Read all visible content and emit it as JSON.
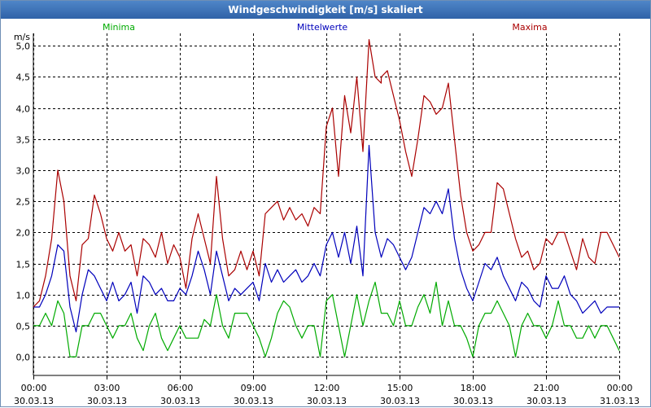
{
  "window": {
    "title": "Windgeschwindigkeit [m/s] skaliert"
  },
  "chart_data": {
    "type": "line",
    "title": "Windgeschwindigkeit [m/s] skaliert",
    "ylabel": "m/s",
    "xlabel": "",
    "ylim": [
      -0.3,
      5.2
    ],
    "xlim": [
      0,
      24
    ],
    "grid": true,
    "legend_placement": "top",
    "y_ticks": [
      "0,0",
      "0,5",
      "1,0",
      "1,5",
      "2,0",
      "2,5",
      "3,0",
      "3,5",
      "4,0",
      "4,5",
      "5,0"
    ],
    "y_tick_values": [
      0,
      0.5,
      1,
      1.5,
      2,
      2.5,
      3,
      3.5,
      4,
      4.5,
      5
    ],
    "x_ticks": [
      {
        "time": "00:00",
        "date": "30.03.13",
        "hour": 0
      },
      {
        "time": "03:00",
        "date": "30.03.13",
        "hour": 3
      },
      {
        "time": "06:00",
        "date": "30.03.13",
        "hour": 6
      },
      {
        "time": "09:00",
        "date": "30.03.13",
        "hour": 9
      },
      {
        "time": "12:00",
        "date": "30.03.13",
        "hour": 12
      },
      {
        "time": "15:00",
        "date": "30.03.13",
        "hour": 15
      },
      {
        "time": "18:00",
        "date": "30.03.13",
        "hour": 18
      },
      {
        "time": "21:00",
        "date": "30.03.13",
        "hour": 21
      },
      {
        "time": "00:00",
        "date": "31.03.13",
        "hour": 24
      }
    ],
    "series": [
      {
        "name": "Minima",
        "color": "#00aa00",
        "points": [
          [
            0,
            0.5
          ],
          [
            0.25,
            0.5
          ],
          [
            0.5,
            0.7
          ],
          [
            0.75,
            0.5
          ],
          [
            1,
            0.9
          ],
          [
            1.25,
            0.7
          ],
          [
            1.5,
            0
          ],
          [
            1.75,
            0
          ],
          [
            2,
            0.5
          ],
          [
            2.25,
            0.5
          ],
          [
            2.5,
            0.7
          ],
          [
            2.75,
            0.7
          ],
          [
            3,
            0.5
          ],
          [
            3.25,
            0.3
          ],
          [
            3.5,
            0.5
          ],
          [
            3.75,
            0.5
          ],
          [
            4,
            0.7
          ],
          [
            4.25,
            0.3
          ],
          [
            4.5,
            0.1
          ],
          [
            4.75,
            0.5
          ],
          [
            5,
            0.7
          ],
          [
            5.25,
            0.3
          ],
          [
            5.5,
            0.1
          ],
          [
            5.75,
            0.3
          ],
          [
            6,
            0.5
          ],
          [
            6.25,
            0.3
          ],
          [
            6.5,
            0.3
          ],
          [
            6.75,
            0.3
          ],
          [
            7,
            0.6
          ],
          [
            7.25,
            0.5
          ],
          [
            7.5,
            1.0
          ],
          [
            7.75,
            0.5
          ],
          [
            8,
            0.3
          ],
          [
            8.25,
            0.7
          ],
          [
            8.5,
            0.7
          ],
          [
            8.75,
            0.7
          ],
          [
            9,
            0.5
          ],
          [
            9.25,
            0.3
          ],
          [
            9.5,
            0
          ],
          [
            9.75,
            0.3
          ],
          [
            10,
            0.7
          ],
          [
            10.25,
            0.9
          ],
          [
            10.5,
            0.8
          ],
          [
            10.75,
            0.5
          ],
          [
            11,
            0.3
          ],
          [
            11.25,
            0.5
          ],
          [
            11.5,
            0.5
          ],
          [
            11.75,
            0
          ],
          [
            12,
            0.9
          ],
          [
            12.25,
            1.0
          ],
          [
            12.5,
            0.5
          ],
          [
            12.75,
            0
          ],
          [
            13,
            0.5
          ],
          [
            13.25,
            1.0
          ],
          [
            13.5,
            0.5
          ],
          [
            13.75,
            0.9
          ],
          [
            14,
            1.2
          ],
          [
            14.25,
            0.7
          ],
          [
            14.5,
            0.7
          ],
          [
            14.75,
            0.5
          ],
          [
            15,
            0.9
          ],
          [
            15.25,
            0.5
          ],
          [
            15.5,
            0.5
          ],
          [
            15.75,
            0.8
          ],
          [
            16,
            1.0
          ],
          [
            16.25,
            0.7
          ],
          [
            16.5,
            1.2
          ],
          [
            16.75,
            0.5
          ],
          [
            17,
            0.9
          ],
          [
            17.25,
            0.5
          ],
          [
            17.5,
            0.5
          ],
          [
            17.75,
            0.3
          ],
          [
            18,
            0
          ],
          [
            18.25,
            0.5
          ],
          [
            18.5,
            0.7
          ],
          [
            18.75,
            0.7
          ],
          [
            19,
            0.9
          ],
          [
            19.25,
            0.7
          ],
          [
            19.5,
            0.5
          ],
          [
            19.75,
            0
          ],
          [
            20,
            0.5
          ],
          [
            20.25,
            0.7
          ],
          [
            20.5,
            0.5
          ],
          [
            20.75,
            0.5
          ],
          [
            21,
            0.3
          ],
          [
            21.25,
            0.5
          ],
          [
            21.5,
            0.9
          ],
          [
            21.75,
            0.5
          ],
          [
            22,
            0.5
          ],
          [
            22.25,
            0.3
          ],
          [
            22.5,
            0.3
          ],
          [
            22.75,
            0.5
          ],
          [
            23,
            0.3
          ],
          [
            23.25,
            0.5
          ],
          [
            23.5,
            0.5
          ],
          [
            23.75,
            0.3
          ],
          [
            24,
            0.1
          ]
        ]
      },
      {
        "name": "Mittelwerte",
        "color": "#0000bb",
        "points": [
          [
            0,
            0.8
          ],
          [
            0.25,
            0.8
          ],
          [
            0.5,
            1.0
          ],
          [
            0.75,
            1.3
          ],
          [
            1,
            1.8
          ],
          [
            1.25,
            1.7
          ],
          [
            1.5,
            0.8
          ],
          [
            1.75,
            0.4
          ],
          [
            2,
            1.0
          ],
          [
            2.25,
            1.4
          ],
          [
            2.5,
            1.3
          ],
          [
            2.75,
            1.1
          ],
          [
            3,
            0.9
          ],
          [
            3.25,
            1.2
          ],
          [
            3.5,
            0.9
          ],
          [
            3.75,
            1.0
          ],
          [
            4,
            1.2
          ],
          [
            4.25,
            0.7
          ],
          [
            4.5,
            1.3
          ],
          [
            4.75,
            1.2
          ],
          [
            5,
            1.0
          ],
          [
            5.25,
            1.1
          ],
          [
            5.5,
            0.9
          ],
          [
            5.75,
            0.9
          ],
          [
            6,
            1.1
          ],
          [
            6.25,
            1.0
          ],
          [
            6.5,
            1.3
          ],
          [
            6.75,
            1.7
          ],
          [
            7,
            1.4
          ],
          [
            7.25,
            1.0
          ],
          [
            7.5,
            1.7
          ],
          [
            7.75,
            1.3
          ],
          [
            8,
            0.9
          ],
          [
            8.25,
            1.1
          ],
          [
            8.5,
            1.0
          ],
          [
            8.75,
            1.1
          ],
          [
            9,
            1.2
          ],
          [
            9.25,
            0.9
          ],
          [
            9.5,
            1.5
          ],
          [
            9.75,
            1.2
          ],
          [
            10,
            1.4
          ],
          [
            10.25,
            1.2
          ],
          [
            10.5,
            1.3
          ],
          [
            10.75,
            1.4
          ],
          [
            11,
            1.2
          ],
          [
            11.25,
            1.3
          ],
          [
            11.5,
            1.5
          ],
          [
            11.75,
            1.3
          ],
          [
            12,
            1.8
          ],
          [
            12.25,
            2.0
          ],
          [
            12.5,
            1.6
          ],
          [
            12.75,
            2.0
          ],
          [
            13,
            1.5
          ],
          [
            13.25,
            2.1
          ],
          [
            13.5,
            1.3
          ],
          [
            13.75,
            3.4
          ],
          [
            14,
            2.0
          ],
          [
            14.25,
            1.6
          ],
          [
            14.5,
            1.9
          ],
          [
            14.75,
            1.8
          ],
          [
            15,
            1.6
          ],
          [
            15.25,
            1.4
          ],
          [
            15.5,
            1.6
          ],
          [
            15.75,
            2.0
          ],
          [
            16,
            2.4
          ],
          [
            16.25,
            2.3
          ],
          [
            16.5,
            2.5
          ],
          [
            16.75,
            2.3
          ],
          [
            17,
            2.7
          ],
          [
            17.25,
            1.9
          ],
          [
            17.5,
            1.4
          ],
          [
            17.75,
            1.1
          ],
          [
            18,
            0.9
          ],
          [
            18.25,
            1.2
          ],
          [
            18.5,
            1.5
          ],
          [
            18.75,
            1.4
          ],
          [
            19,
            1.6
          ],
          [
            19.25,
            1.3
          ],
          [
            19.5,
            1.1
          ],
          [
            19.75,
            0.9
          ],
          [
            20,
            1.2
          ],
          [
            20.25,
            1.1
          ],
          [
            20.5,
            0.9
          ],
          [
            20.75,
            0.8
          ],
          [
            21,
            1.3
          ],
          [
            21.25,
            1.1
          ],
          [
            21.5,
            1.1
          ],
          [
            21.75,
            1.3
          ],
          [
            22,
            1.0
          ],
          [
            22.25,
            0.9
          ],
          [
            22.5,
            0.7
          ],
          [
            22.75,
            0.8
          ],
          [
            23,
            0.9
          ],
          [
            23.25,
            0.7
          ],
          [
            23.5,
            0.8
          ],
          [
            23.75,
            0.8
          ],
          [
            24,
            0.8
          ]
        ]
      },
      {
        "name": "Maxima",
        "color": "#aa0000",
        "points": [
          [
            0,
            0.8
          ],
          [
            0.25,
            0.9
          ],
          [
            0.5,
            1.3
          ],
          [
            0.75,
            1.9
          ],
          [
            1,
            3.0
          ],
          [
            1.25,
            2.5
          ],
          [
            1.5,
            1.3
          ],
          [
            1.75,
            0.9
          ],
          [
            2,
            1.8
          ],
          [
            2.25,
            1.9
          ],
          [
            2.5,
            2.6
          ],
          [
            2.75,
            2.3
          ],
          [
            3,
            1.9
          ],
          [
            3.25,
            1.7
          ],
          [
            3.5,
            2.0
          ],
          [
            3.75,
            1.7
          ],
          [
            4,
            1.8
          ],
          [
            4.25,
            1.3
          ],
          [
            4.5,
            1.9
          ],
          [
            4.75,
            1.8
          ],
          [
            5,
            1.6
          ],
          [
            5.25,
            2.0
          ],
          [
            5.5,
            1.5
          ],
          [
            5.75,
            1.8
          ],
          [
            6,
            1.6
          ],
          [
            6.25,
            1.1
          ],
          [
            6.5,
            1.9
          ],
          [
            6.75,
            2.3
          ],
          [
            7,
            1.9
          ],
          [
            7.25,
            1.5
          ],
          [
            7.5,
            2.9
          ],
          [
            7.75,
            1.9
          ],
          [
            8,
            1.3
          ],
          [
            8.25,
            1.4
          ],
          [
            8.5,
            1.7
          ],
          [
            8.75,
            1.4
          ],
          [
            9,
            1.7
          ],
          [
            9.25,
            1.3
          ],
          [
            9.5,
            2.3
          ],
          [
            9.75,
            2.4
          ],
          [
            10,
            2.5
          ],
          [
            10.25,
            2.2
          ],
          [
            10.5,
            2.4
          ],
          [
            10.75,
            2.2
          ],
          [
            11,
            2.3
          ],
          [
            11.25,
            2.1
          ],
          [
            11.5,
            2.4
          ],
          [
            11.75,
            2.3
          ],
          [
            12,
            3.7
          ],
          [
            12.25,
            4.0
          ],
          [
            12.5,
            2.9
          ],
          [
            12.75,
            4.2
          ],
          [
            13,
            3.6
          ],
          [
            13.25,
            4.5
          ],
          [
            13.5,
            3.3
          ],
          [
            13.75,
            5.1
          ],
          [
            14,
            4.5
          ],
          [
            14.25,
            4.4
          ],
          [
            14.25,
            4.5
          ],
          [
            14.5,
            4.6
          ],
          [
            14.75,
            4.2
          ],
          [
            15,
            3.8
          ],
          [
            15.25,
            3.3
          ],
          [
            15.5,
            2.9
          ],
          [
            15.75,
            3.5
          ],
          [
            16,
            4.2
          ],
          [
            16.25,
            4.1
          ],
          [
            16.5,
            3.9
          ],
          [
            16.75,
            4.0
          ],
          [
            17,
            4.4
          ],
          [
            17.25,
            3.5
          ],
          [
            17.5,
            2.6
          ],
          [
            17.75,
            2.0
          ],
          [
            18,
            1.7
          ],
          [
            18.25,
            1.8
          ],
          [
            18.5,
            2.0
          ],
          [
            18.75,
            2.0
          ],
          [
            19,
            2.8
          ],
          [
            19.25,
            2.7
          ],
          [
            19.5,
            2.3
          ],
          [
            19.75,
            1.9
          ],
          [
            20,
            1.6
          ],
          [
            20.25,
            1.7
          ],
          [
            20.5,
            1.4
          ],
          [
            20.75,
            1.5
          ],
          [
            21,
            1.9
          ],
          [
            21.25,
            1.8
          ],
          [
            21.5,
            2.0
          ],
          [
            21.75,
            2.0
          ],
          [
            22,
            1.7
          ],
          [
            22.25,
            1.4
          ],
          [
            22.5,
            1.9
          ],
          [
            22.75,
            1.6
          ],
          [
            23,
            1.5
          ],
          [
            23.25,
            2.0
          ],
          [
            23.5,
            2.0
          ],
          [
            23.75,
            1.8
          ],
          [
            24,
            1.6
          ]
        ]
      }
    ]
  }
}
